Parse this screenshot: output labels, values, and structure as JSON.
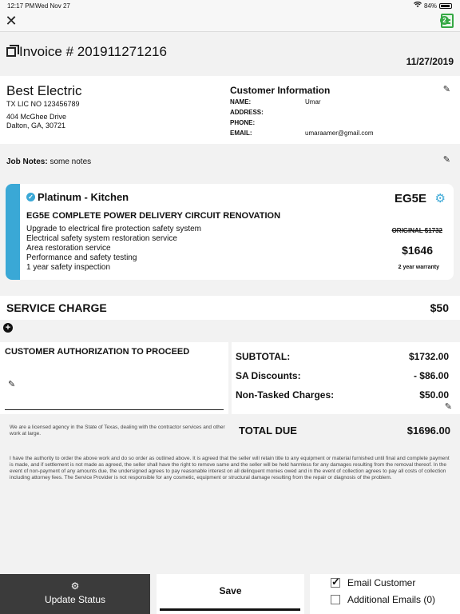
{
  "status_bar": {
    "time": "12:17 PM",
    "date": "Wed Nov 27",
    "battery": "84%"
  },
  "nav": {
    "close_icon": "close-icon",
    "notes_badge": "2",
    "notes_icon": "notes-icon"
  },
  "invoice": {
    "title": "Invoice # 201911271216",
    "date": "11/27/2019"
  },
  "company": {
    "name": "Best Electric",
    "license": "TX LIC NO 123456789",
    "address_line1": "404 McGhee Drive",
    "address_line2": "Dalton, GA, 30721"
  },
  "customer": {
    "title": "Customer Information",
    "name_label": "NAME:",
    "name_value": "Umar",
    "address_label": "ADDRESS:",
    "address_value": "",
    "phone_label": "PHONE:",
    "phone_value": "",
    "email_label": "EMAIL:",
    "email_value": "umaraamer@gmail.com"
  },
  "job_notes": {
    "label": "Job Notes:",
    "value": "some notes"
  },
  "task": {
    "tier": "Platinum - Kitchen",
    "code": "EG5E",
    "heading": "EG5E COMPLETE POWER DELIVERY CIRCUIT RENOVATION",
    "items": [
      "Upgrade to electrical fire protection safety system",
      "Electrical safety system restoration service",
      "Area restoration service",
      "Performance and safety testing",
      "1 year safety inspection"
    ],
    "original_price": "ORIGINAL $1732",
    "price": "$1646",
    "warranty": "2 year warranty",
    "accent_color": "#3aa8d6"
  },
  "service_charge": {
    "label": "SERVICE CHARGE",
    "amount": "$50"
  },
  "authorization": {
    "title": "CUSTOMER AUTHORIZATION TO PROCEED"
  },
  "totals": {
    "subtotal_label": "SUBTOTAL:",
    "subtotal": "$1732.00",
    "discount_label": "SA Discounts:",
    "discount": "- $86.00",
    "nontasked_label": "Non-Tasked Charges:",
    "nontasked": "$50.00",
    "total_due_label": "TOTAL DUE",
    "total_due": "$1696.00"
  },
  "disclaimer": "We are a licensed agency in the State of Texas, dealing with the contractor services and other work at large.",
  "legal": "I have the authority to order the above work and do so order as outlined above. It is agreed that the seller will retain title to any equipment or material furnished until final and complete payment is made, and if settlement is not made as agreed, the seller shall have the right to remove same and the seller will be held harmless for any damages resulting from the removal thereof. In the event of non-payment of any amounts due, the undersigned agrees to pay reasonable interest on all delinquent monies owed and in the event of collection agrees to pay all costs of collection including attorney fees. The Service Provider is not responsible for any cosmetic, equipment or structural damage resulting from the repair or diagnosis of the problem.",
  "actions": {
    "update_status": "Update Status",
    "save": "Save",
    "email_customer": "Email Customer",
    "email_customer_checked": true,
    "additional_emails": "Additional Emails (0)",
    "additional_emails_checked": false
  }
}
